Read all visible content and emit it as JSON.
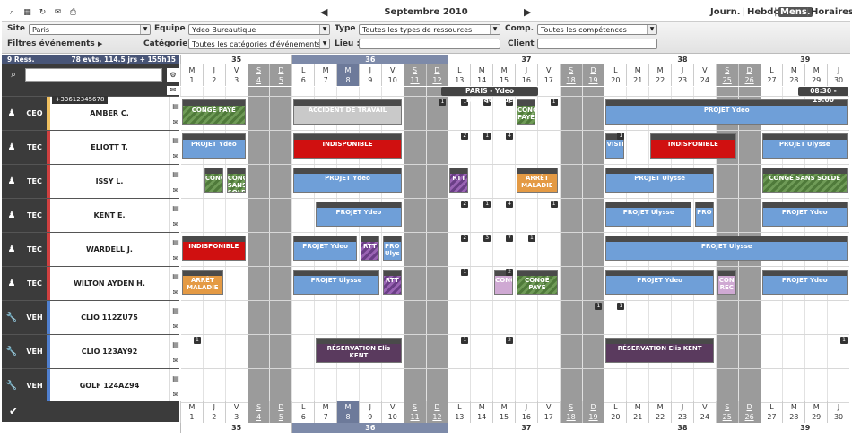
{
  "toolbar": {
    "month_title": "Septembre 2010",
    "views": [
      "Journ.",
      "Hebdo.",
      "Mens.",
      "Horaires"
    ],
    "active_view": "Mens."
  },
  "filters": {
    "site_label": "Site :",
    "site_value": "Paris",
    "equipe_label": "Equipe :",
    "equipe_value": "Ydeo Bureautique",
    "type_label": "Type :",
    "type_value": "Toutes les types de ressources",
    "comp_label": "Comp. :",
    "comp_value": "Toutes les compétences",
    "events_filter_label": "Filtres événements",
    "categorie_label": "Catégorie :",
    "categorie_value": "Toutes les catégories d'événements",
    "lieu_label": "Lieu :",
    "client_label": "Client :"
  },
  "summary": {
    "resources": "9 Ress.",
    "stats": "78 evts, 114.5 jrs + 155h15"
  },
  "weeks": [
    {
      "num": "35",
      "start": 0,
      "span": 5
    },
    {
      "num": "36",
      "start": 5,
      "span": 7
    },
    {
      "num": "37",
      "start": 12,
      "span": 7
    },
    {
      "num": "38",
      "start": 19,
      "span": 7
    },
    {
      "num": "39",
      "start": 26,
      "span": 4
    }
  ],
  "days": [
    {
      "l": "M",
      "n": "1"
    },
    {
      "l": "J",
      "n": "2"
    },
    {
      "l": "V",
      "n": "3"
    },
    {
      "l": "S",
      "n": "4",
      "we": true
    },
    {
      "l": "D",
      "n": "5",
      "we": true
    },
    {
      "l": "L",
      "n": "6"
    },
    {
      "l": "M",
      "n": "7"
    },
    {
      "l": "M",
      "n": "8",
      "today": true
    },
    {
      "l": "J",
      "n": "9"
    },
    {
      "l": "V",
      "n": "10"
    },
    {
      "l": "S",
      "n": "11",
      "we": true
    },
    {
      "l": "D",
      "n": "12",
      "we": true
    },
    {
      "l": "L",
      "n": "13"
    },
    {
      "l": "M",
      "n": "14"
    },
    {
      "l": "M",
      "n": "15"
    },
    {
      "l": "J",
      "n": "16"
    },
    {
      "l": "V",
      "n": "17"
    },
    {
      "l": "S",
      "n": "18",
      "we": true
    },
    {
      "l": "D",
      "n": "19",
      "we": true
    },
    {
      "l": "L",
      "n": "20"
    },
    {
      "l": "M",
      "n": "21"
    },
    {
      "l": "M",
      "n": "22"
    },
    {
      "l": "J",
      "n": "23"
    },
    {
      "l": "V",
      "n": "24"
    },
    {
      "l": "S",
      "n": "25",
      "we": true
    },
    {
      "l": "D",
      "n": "26",
      "we": true
    },
    {
      "l": "L",
      "n": "27"
    },
    {
      "l": "M",
      "n": "28"
    },
    {
      "l": "M",
      "n": "29"
    },
    {
      "l": "J",
      "n": "30"
    }
  ],
  "band": {
    "site": "PARIS - Ydeo Bureautique",
    "hours": "08:30 - 19:00",
    "phone": "+33612345678"
  },
  "resources": [
    {
      "type": "CEQ",
      "name": "AMBER C.",
      "strip": "#f0c060",
      "icon": "person-icon"
    },
    {
      "type": "TEC",
      "name": "ELIOTT T.",
      "strip": "#d04040",
      "icon": "person-icon"
    },
    {
      "type": "TEC",
      "name": "ISSY L.",
      "strip": "#d04040",
      "icon": "person-icon"
    },
    {
      "type": "TEC",
      "name": "KENT E.",
      "strip": "#d04040",
      "icon": "person-icon"
    },
    {
      "type": "TEC",
      "name": "WARDELL J.",
      "strip": "#d04040",
      "icon": "person-icon"
    },
    {
      "type": "TEC",
      "name": "WILTON AYDEN H.",
      "strip": "#d04040",
      "icon": "person-icon"
    },
    {
      "type": "VEH",
      "name": "CLIO 112ZU75",
      "strip": "#5080d0",
      "icon": "wrench-icon"
    },
    {
      "type": "VEH",
      "name": "CLIO 123AY92",
      "strip": "#5080d0",
      "icon": "wrench-icon"
    },
    {
      "type": "VEH",
      "name": "GOLF 124AZ94",
      "strip": "#5080d0",
      "icon": "wrench-icon"
    }
  ],
  "events": [
    {
      "row": 0,
      "d0": 0,
      "d1": 3,
      "cls": "green",
      "text": "CONGÉ PAYÉ"
    },
    {
      "row": 0,
      "d0": 5,
      "d1": 10,
      "cls": "grey",
      "text": "ACCIDENT DE TRAVAIL"
    },
    {
      "row": 0,
      "d0": 15,
      "d1": 16,
      "cls": "green",
      "text": "CONG PAYÉ"
    },
    {
      "row": 0,
      "d0": 19,
      "d1": 30,
      "cls": "blue",
      "text": "PROJET Ydeo"
    },
    {
      "row": 1,
      "d0": 0,
      "d1": 3,
      "cls": "blue",
      "text": "PROJET Ydeo"
    },
    {
      "row": 1,
      "d0": 5,
      "d1": 10,
      "cls": "red",
      "text": "INDISPONIBLE"
    },
    {
      "row": 1,
      "d0": 19,
      "d1": 20,
      "cls": "blue",
      "text": "VISITE"
    },
    {
      "row": 1,
      "d0": 21,
      "d1": 25,
      "cls": "red",
      "text": "INDISPONIBLE"
    },
    {
      "row": 1,
      "d0": 26,
      "d1": 30,
      "cls": "blue",
      "text": "PROJET Ulysse"
    },
    {
      "row": 2,
      "d0": 1,
      "d1": 2,
      "cls": "green",
      "text": "CONG"
    },
    {
      "row": 2,
      "d0": 2,
      "d1": 3,
      "cls": "green",
      "text": "CONG SANS SOLD"
    },
    {
      "row": 2,
      "d0": 5,
      "d1": 10,
      "cls": "blue",
      "text": "PROJET Ydeo"
    },
    {
      "row": 2,
      "d0": 12,
      "d1": 13,
      "cls": "purple",
      "text": "RTT"
    },
    {
      "row": 2,
      "d0": 15,
      "d1": 17,
      "cls": "orange",
      "text": "ARRÊT MALADIE"
    },
    {
      "row": 2,
      "d0": 19,
      "d1": 24,
      "cls": "blue",
      "text": "PROJET Ulysse"
    },
    {
      "row": 2,
      "d0": 26,
      "d1": 30,
      "cls": "green",
      "text": "CONGÉ SANS SOLDE"
    },
    {
      "row": 3,
      "d0": 6,
      "d1": 10,
      "cls": "blue",
      "text": "PROJET Ydeo"
    },
    {
      "row": 3,
      "d0": 19,
      "d1": 23,
      "cls": "blue",
      "text": "PROJET Ulysse"
    },
    {
      "row": 3,
      "d0": 23,
      "d1": 24,
      "cls": "blue",
      "text": "PRO"
    },
    {
      "row": 3,
      "d0": 26,
      "d1": 30,
      "cls": "blue",
      "text": "PROJET Ydeo"
    },
    {
      "row": 4,
      "d0": 0,
      "d1": 3,
      "cls": "red",
      "text": "INDISPONIBLE"
    },
    {
      "row": 4,
      "d0": 5,
      "d1": 8,
      "cls": "blue",
      "text": "PROJET Ydeo"
    },
    {
      "row": 4,
      "d0": 8,
      "d1": 9,
      "cls": "purple",
      "text": "RTT"
    },
    {
      "row": 4,
      "d0": 9,
      "d1": 10,
      "cls": "blue",
      "text": "PRO Ulys"
    },
    {
      "row": 4,
      "d0": 19,
      "d1": 30,
      "cls": "blue",
      "text": "PROJET Ulysse"
    },
    {
      "row": 5,
      "d0": 0,
      "d1": 2,
      "cls": "orange",
      "text": "ARRÊT MALADIE"
    },
    {
      "row": 5,
      "d0": 5,
      "d1": 9,
      "cls": "blue",
      "text": "PROJET Ulysse"
    },
    {
      "row": 5,
      "d0": 9,
      "d1": 10,
      "cls": "purple",
      "text": "RTT"
    },
    {
      "row": 5,
      "d0": 14,
      "d1": 15,
      "cls": "pink",
      "text": "CONG"
    },
    {
      "row": 5,
      "d0": 15,
      "d1": 17,
      "cls": "green",
      "text": "CONGÉ PAYÉ"
    },
    {
      "row": 5,
      "d0": 19,
      "d1": 24,
      "cls": "blue",
      "text": "PROJET Ydeo"
    },
    {
      "row": 5,
      "d0": 24,
      "d1": 25,
      "cls": "pink",
      "text": "CON REC"
    },
    {
      "row": 5,
      "d0": 26,
      "d1": 30,
      "cls": "blue",
      "text": "PROJET Ydeo"
    },
    {
      "row": 7,
      "d0": 6,
      "d1": 10,
      "cls": "plum",
      "text": "RÉSERVATION Elis KENT"
    },
    {
      "row": 7,
      "d0": 19,
      "d1": 24,
      "cls": "plum",
      "text": "RÉSERVATION Elis KENT"
    }
  ],
  "counts": [
    {
      "row": 0,
      "d": 11,
      "v": "1"
    },
    {
      "row": 0,
      "d": 12,
      "v": "1"
    },
    {
      "row": 0,
      "d": 13,
      "v": "1"
    },
    {
      "row": 0,
      "d": 14,
      "v": "3"
    },
    {
      "row": 0,
      "d": 16,
      "v": "1"
    },
    {
      "row": 1,
      "d": 12,
      "v": "2"
    },
    {
      "row": 1,
      "d": 13,
      "v": "1"
    },
    {
      "row": 1,
      "d": 14,
      "v": "4"
    },
    {
      "row": 1,
      "d": 19,
      "v": "1"
    },
    {
      "row": 3,
      "d": 12,
      "v": "2"
    },
    {
      "row": 3,
      "d": 13,
      "v": "1"
    },
    {
      "row": 3,
      "d": 14,
      "v": "4"
    },
    {
      "row": 3,
      "d": 16,
      "v": "1"
    },
    {
      "row": 4,
      "d": 12,
      "v": "2"
    },
    {
      "row": 4,
      "d": 13,
      "v": "3"
    },
    {
      "row": 4,
      "d": 14,
      "v": "7"
    },
    {
      "row": 4,
      "d": 15,
      "v": "1"
    },
    {
      "row": 5,
      "d": 12,
      "v": "1"
    },
    {
      "row": 5,
      "d": 14,
      "v": "2"
    },
    {
      "row": 6,
      "d": 18,
      "v": "1"
    },
    {
      "row": 6,
      "d": 19,
      "v": "1"
    },
    {
      "row": 7,
      "d": 0,
      "v": "1"
    },
    {
      "row": 7,
      "d": 12,
      "v": "1"
    },
    {
      "row": 7,
      "d": 14,
      "v": "2"
    },
    {
      "row": 7,
      "d": 29,
      "v": "1"
    }
  ]
}
